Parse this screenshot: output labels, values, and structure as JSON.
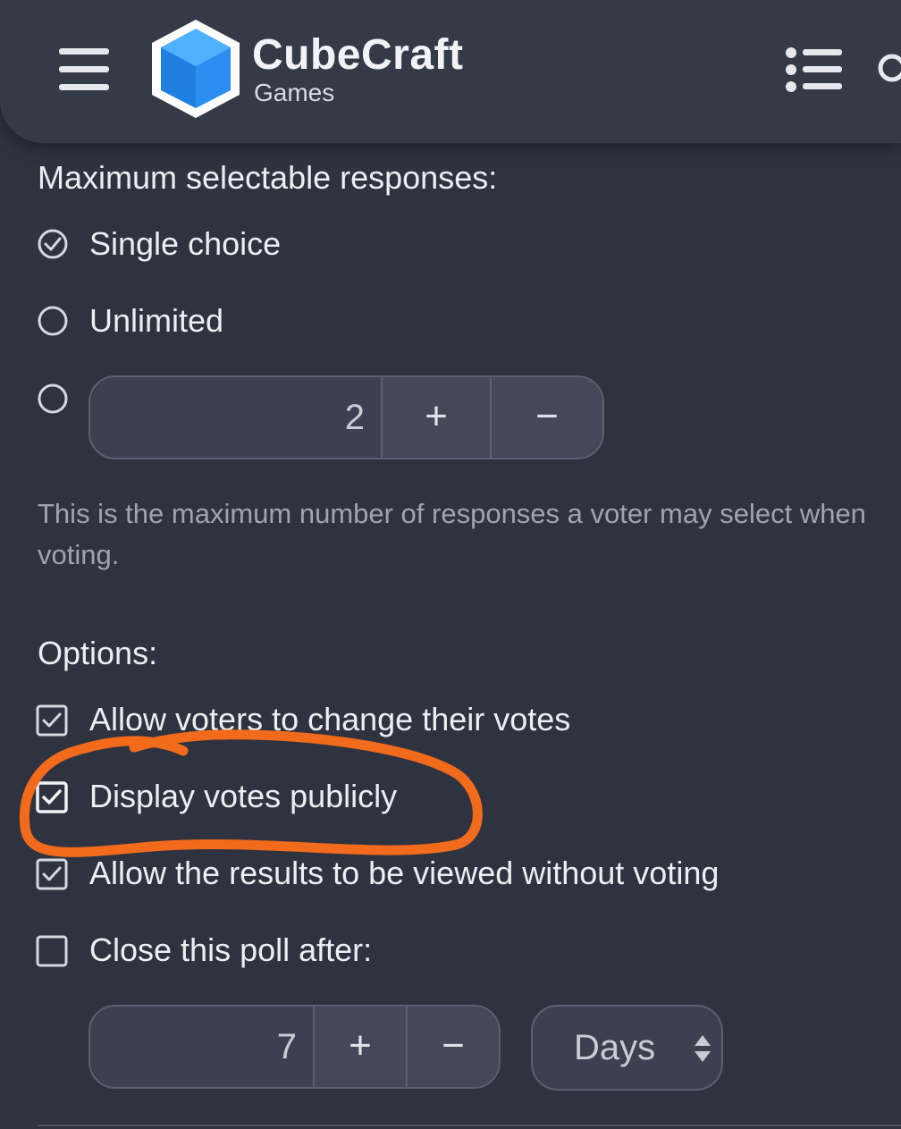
{
  "header": {
    "brand_name": "CubeCraft",
    "brand_sub": "Games",
    "icons": [
      "hamburger-icon",
      "cube-logo-icon",
      "list-icon",
      "search-icon"
    ]
  },
  "max_responses": {
    "label": "Maximum selectable responses:",
    "options": [
      {
        "label": "Single choice",
        "selected": true
      },
      {
        "label": "Unlimited",
        "selected": false
      }
    ],
    "custom": {
      "value": "2",
      "plus": "+",
      "minus": "−",
      "selected": false
    },
    "help": "This is the maximum number of responses a voter may select when voting."
  },
  "options": {
    "label": "Options:",
    "items": [
      {
        "label": "Allow voters to change their votes",
        "checked": true
      },
      {
        "label": "Display votes publicly",
        "checked": true
      },
      {
        "label": "Allow the results to be viewed without voting",
        "checked": true
      },
      {
        "label": "Close this poll after:",
        "checked": false
      }
    ],
    "close_after": {
      "value": "7",
      "plus": "+",
      "minus": "−",
      "unit": "Days"
    }
  },
  "colors": {
    "background": "#2f3340",
    "header": "#353a47",
    "annotation": "#f26a1b",
    "logo": "#2b8ef0"
  }
}
